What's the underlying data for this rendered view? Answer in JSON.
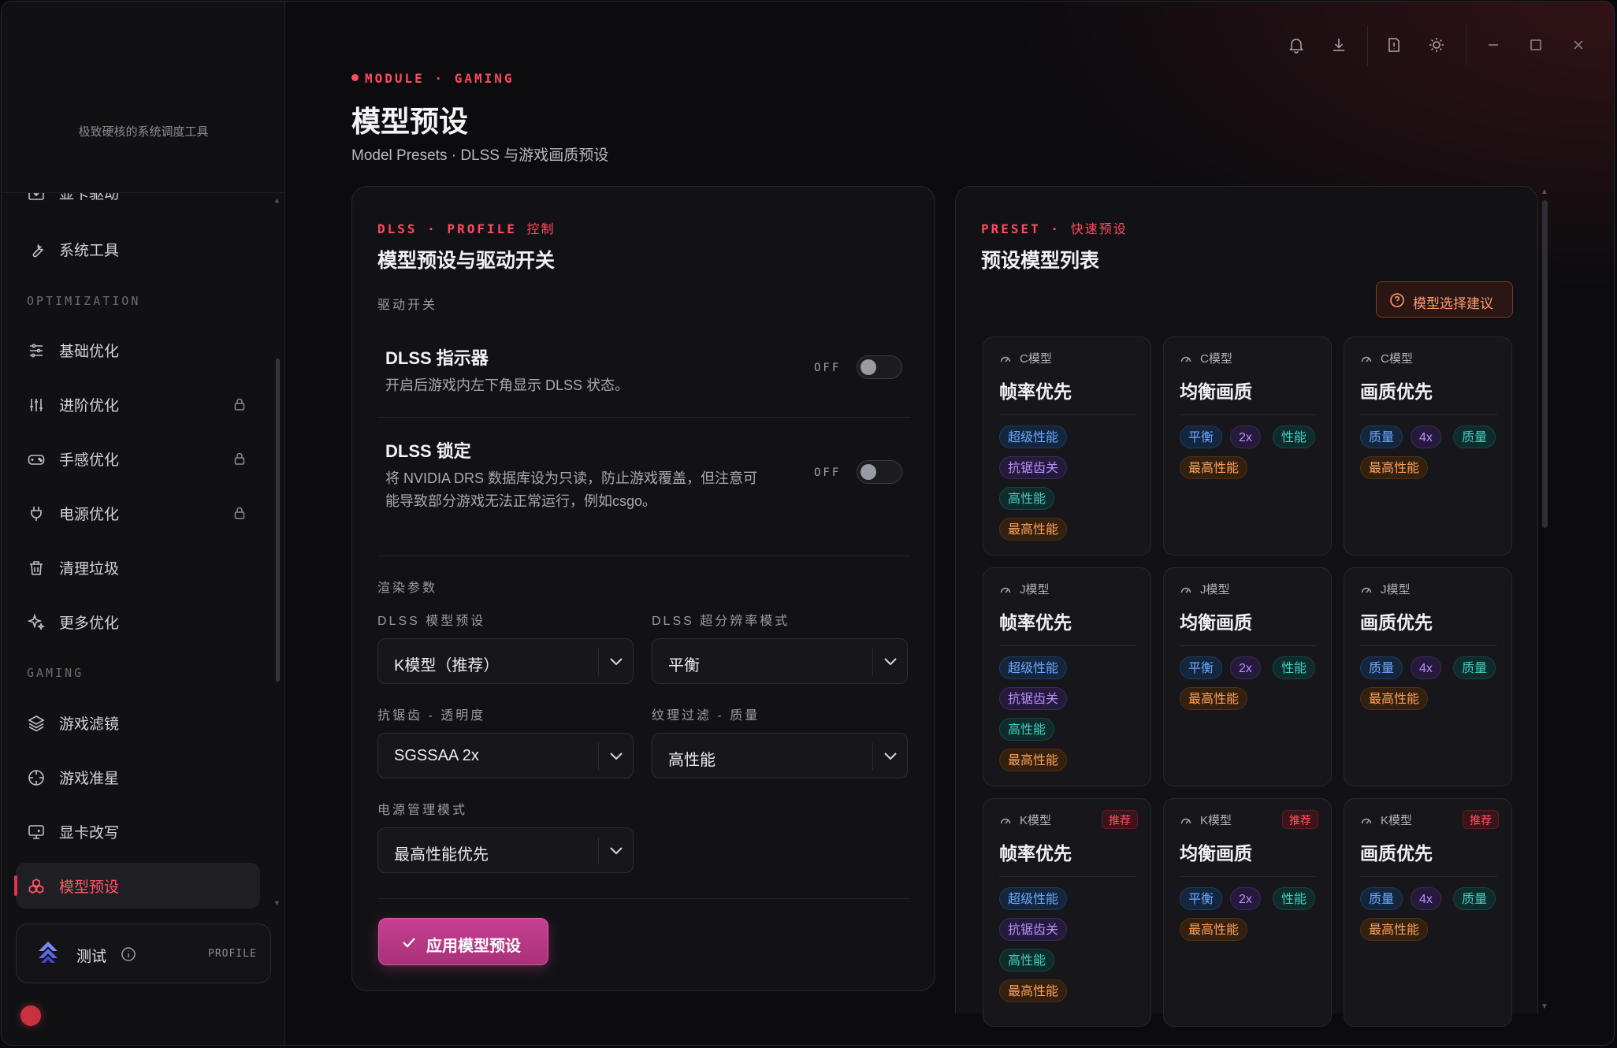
{
  "app": {
    "tagline": "极致硬核的系统调度工具"
  },
  "sidebar": {
    "partial_item": "显卡驱动",
    "items_top": [
      {
        "label": "系统工具",
        "icon": "wrench-icon"
      }
    ],
    "sections": {
      "optimization": "OPTIMIZATION",
      "gaming": "GAMING"
    },
    "optimization": [
      {
        "label": "基础优化",
        "icon": "sliders-icon",
        "locked": false
      },
      {
        "label": "进阶优化",
        "icon": "equalizer-icon",
        "locked": true
      },
      {
        "label": "手感优化",
        "icon": "gamepad-icon",
        "locked": true
      },
      {
        "label": "电源优化",
        "icon": "plug-icon",
        "locked": true
      },
      {
        "label": "清理垃圾",
        "icon": "trash-icon",
        "locked": false
      },
      {
        "label": "更多优化",
        "icon": "sparkle-icon",
        "locked": false
      }
    ],
    "gaming": [
      {
        "label": "游戏滤镜",
        "icon": "layers-icon"
      },
      {
        "label": "游戏准星",
        "icon": "crosshair-icon"
      },
      {
        "label": "显卡改写",
        "icon": "monitor-icon"
      },
      {
        "label": "模型预设",
        "icon": "cubes-icon",
        "active": true
      }
    ],
    "profile": {
      "name": "测试",
      "tag": "PROFILE"
    }
  },
  "topbar": {
    "icons": [
      "bell-icon",
      "download-icon",
      "info-icon",
      "sun-icon",
      "minimize-icon",
      "maximize-icon",
      "close-icon"
    ]
  },
  "header": {
    "eyebrow": "MODULE · GAMING",
    "title": "模型预设",
    "subtitle": "Model Presets · DLSS 与游戏画质预设"
  },
  "left_card": {
    "kicker": "DLSS · PROFILE",
    "kicker_suffix": "控制",
    "title": "模型预设与驱动开关",
    "driver_label": "驱动开关",
    "toggles": [
      {
        "title": "DLSS 指示器",
        "desc": "开启后游戏内左下角显示 DLSS 状态。",
        "state": "OFF"
      },
      {
        "title": "DLSS 锁定",
        "desc1": "将 NVIDIA DRS 数据库设为只读，防止游戏覆盖，但注意可",
        "desc2": "能导致部分游戏无法正常运行，例如csgo。",
        "state": "OFF"
      }
    ],
    "render_label": "渲染参数",
    "fields": [
      {
        "label": "DLSS  模型预设",
        "value": "K模型（推荐）"
      },
      {
        "label": "DLSS  超分辨率模式",
        "value": "平衡"
      },
      {
        "label": "抗锯齿  -  透明度",
        "value": "SGSSAA 2x"
      },
      {
        "label": "纹理过滤  -  质量",
        "value": "高性能"
      },
      {
        "label": "电源管理模式",
        "value": "最高性能优先"
      }
    ],
    "apply_label": "应用模型预设"
  },
  "right_card": {
    "kicker": "PRESET ·",
    "kicker_suffix": "快速预设",
    "title": "预设模型列表",
    "advice_label": "模型选择建议",
    "recommend_label": "推荐",
    "rows": [
      {
        "model": "C模型",
        "rec": false
      },
      {
        "model": "J模型",
        "rec": false
      },
      {
        "model": "K模型",
        "rec": true
      }
    ],
    "columns": [
      {
        "title": "帧率优先",
        "pills": [
          [
            "超级性能",
            "blue"
          ],
          [
            "抗锯齿关",
            "purple"
          ],
          [
            "高性能",
            "teal"
          ],
          [
            "最高性能",
            "orange"
          ]
        ]
      },
      {
        "title": "均衡画质",
        "pills": [
          [
            "平衡",
            "blue"
          ],
          [
            "2x",
            "purple"
          ],
          [
            "性能",
            "teal"
          ],
          [
            "最高性能",
            "orange"
          ]
        ]
      },
      {
        "title": "画质优先",
        "pills": [
          [
            "质量",
            "blue"
          ],
          [
            "4x",
            "purple"
          ],
          [
            "质量",
            "teal"
          ],
          [
            "最高性能",
            "orange"
          ]
        ]
      }
    ]
  }
}
